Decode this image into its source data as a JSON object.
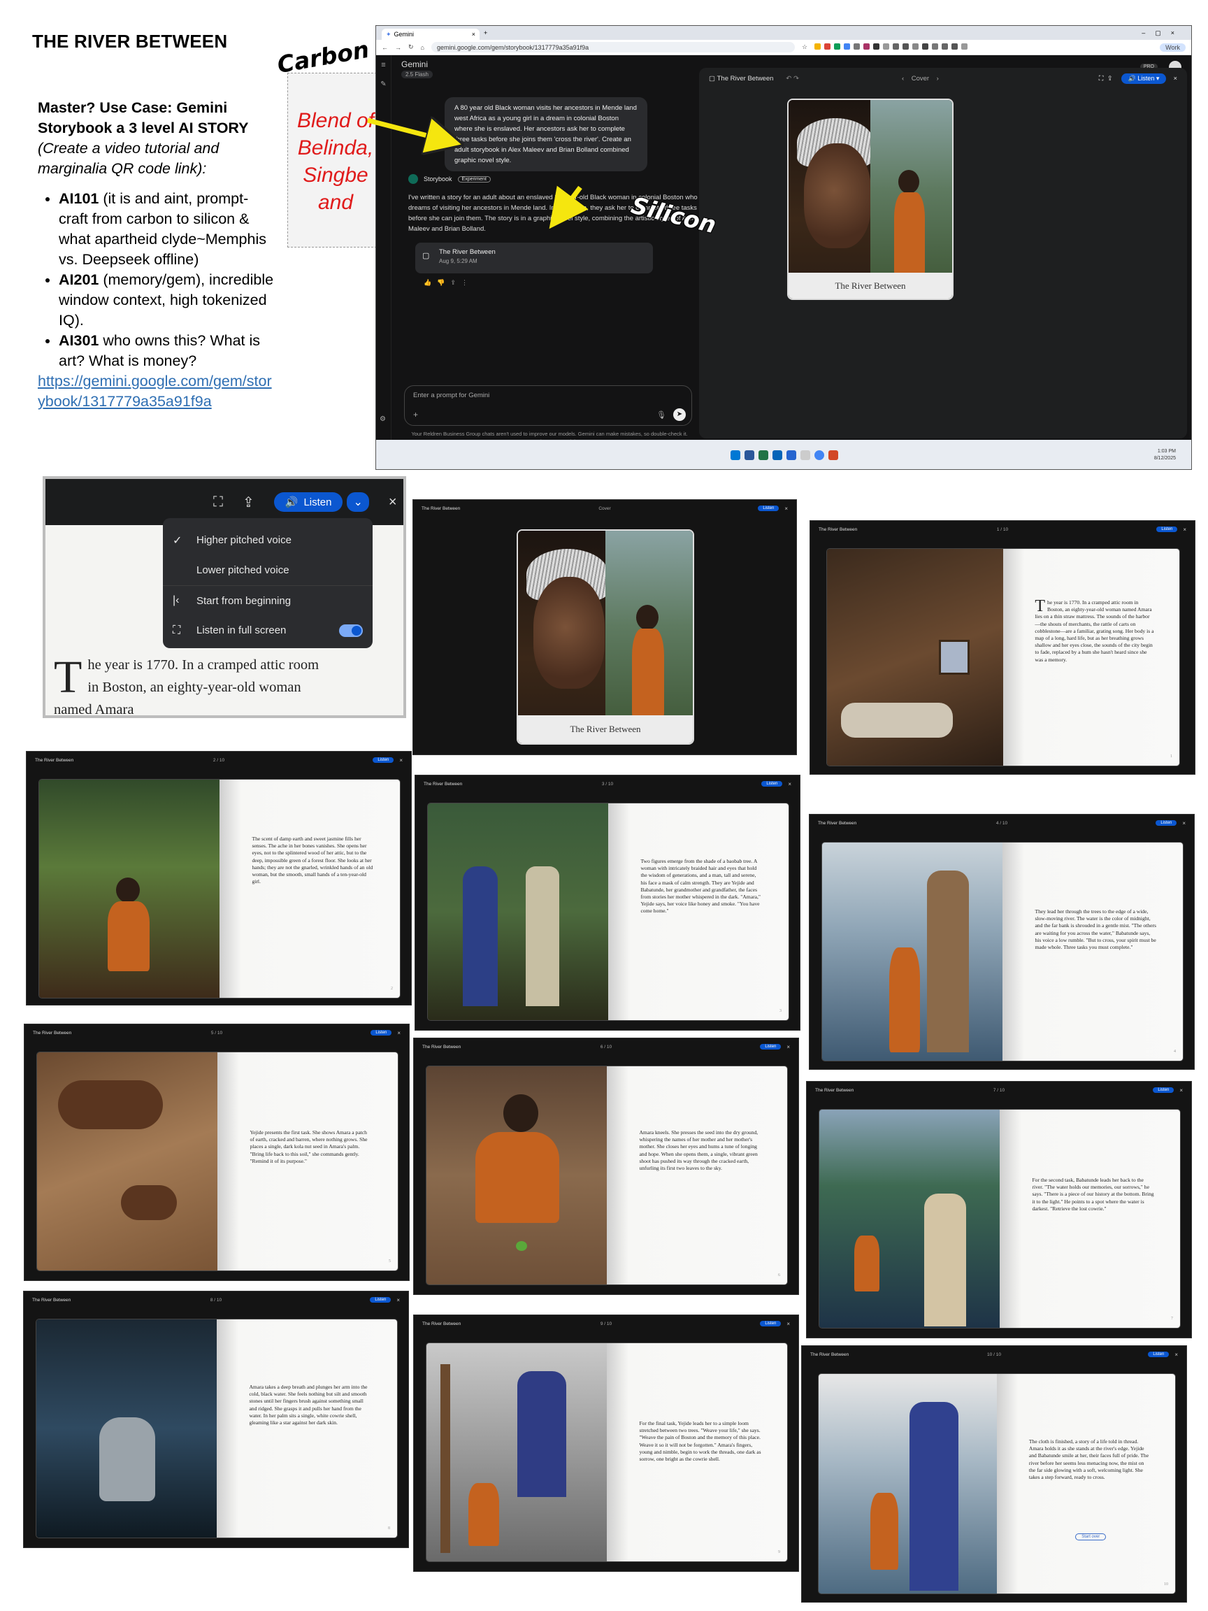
{
  "doc_title": "THE RIVER BETWEEN",
  "notes": {
    "heading": "Master? Use Case: Gemini Storybook a 3 level AI STORY",
    "subheading": "(Create a video tutorial and marginalia QR code link):",
    "items": [
      {
        "label": "AI101",
        "text": " (it is and aint, prompt-craft from carbon to silicon & what apartheid clyde~Memphis vs. Deepseek offline)"
      },
      {
        "label": "AI201",
        "text": " (memory/gem), incredible window context, high tokenized IQ)."
      },
      {
        "label": "AI301",
        "text": " who owns this? What is art? What is money?"
      }
    ],
    "link": "https://gemini.google.com/gem/storybook/1317779a35a91f9a"
  },
  "callouts": {
    "carbon": "Carbon",
    "silicon": "Silicon"
  },
  "sticky": "Blend of Belinda, Singbe and",
  "browser": {
    "tab_title": "Gemini",
    "url": "gemini.google.com/gem/storybook/1317779a35a91f9a",
    "profile": "Work",
    "app_name": "Gemini",
    "model": "2.5 Flash",
    "pro_badge": "PRO",
    "user_prompt": "A 80 year old Black woman visits her ancestors in Mende land west Africa as a young girl in a dream in colonial Boston where she is enslaved. Her ancestors ask her to complete three tasks before she joins them 'cross the river'. Create an adult storybook in Alex Maleev and Brian Bolland combined graphic novel style.",
    "bot_name": "Storybook",
    "bot_badge": "Experiment",
    "bot_reply": "I've written a story for an adult about an enslaved 80-year-old Black woman in colonial Boston who dreams of visiting her ancestors in Mende land. In the dream, they ask her to complete three tasks before she can join them. The story is in a graphic novel style, combining the artistic styles of Alex Maleev and Brian Bolland.",
    "story_card_title": "The River Between",
    "story_card_date": "Aug 9, 5:29 AM",
    "prompt_placeholder": "Enter a prompt for Gemini",
    "footnote": "Your Reldren Business Group chats aren't used to improve our models. Gemini can make mistakes, so double-check it. Your privacy & Gemini",
    "canvas_title": "The River Between",
    "canvas_page": "Cover",
    "listen": "Listen",
    "cover_title": "The River Between",
    "clock_time": "1:03 PM",
    "clock_date": "8/12/2025"
  },
  "zoom": {
    "listen": "Listen",
    "menu": [
      "Higher pitched voice",
      "Lower pitched voice",
      "Start from beginning",
      "Listen in full screen"
    ],
    "text": "he year is 1770. In a cramped attic room in Boston, an eighty-year-old woman named Amara",
    "dropcap": "T"
  },
  "pages": {
    "title": "The River Between",
    "listen": "Listen",
    "cover": {
      "label": "Cover",
      "title": "The River Between"
    },
    "p1": {
      "label": "1 / 10",
      "num": "1",
      "dropcap": "T",
      "text": "he year is 1770. In a cramped attic room in Boston, an eighty-year-old woman named Amara lies on a thin straw mattress. The sounds of the harbor—the shouts of merchants, the rattle of carts on cobblestone—are a familiar, grating song. Her body is a map of a long, hard life, but as her breathing grows shallow and her eyes close, the sounds of the city begin to fade, replaced by a hum she hasn't heard since she was a memory."
    },
    "p2": {
      "label": "2 / 10",
      "num": "2",
      "text": "The scent of damp earth and sweet jasmine fills her senses. The ache in her bones vanishes. She opens her eyes, not to the splintered wood of her attic, but to the deep, impossible green of a forest floor. She looks at her hands; they are not the gnarled, wrinkled hands of an old woman, but the smooth, small hands of a ten-year-old girl."
    },
    "p3": {
      "label": "3 / 10",
      "num": "3",
      "text": "Two figures emerge from the shade of a baobab tree. A woman with intricately braided hair and eyes that hold the wisdom of generations, and a man, tall and serene, his face a mask of calm strength. They are Yejide and Babatunde, her grandmother and grandfather, the faces from stories her mother whispered in the dark. \"Amara,\" Yejide says, her voice like honey and smoke. \"You have come home.\""
    },
    "p4": {
      "label": "4 / 10",
      "num": "4",
      "text": "They lead her through the trees to the edge of a wide, slow-moving river. The water is the color of midnight, and the far bank is shrouded in a gentle mist. \"The others are waiting for you across the water,\" Babatunde says, his voice a low rumble. \"But to cross, your spirit must be made whole. Three tasks you must complete.\""
    },
    "p5": {
      "label": "5 / 10",
      "num": "5",
      "text": "Yejide presents the first task. She shows Amara a patch of earth, cracked and barren, where nothing grows. She places a single, dark kola nut seed in Amara's palm. \"Bring life back to this soil,\" she commands gently. \"Remind it of its purpose.\""
    },
    "p6": {
      "label": "6 / 10",
      "num": "6",
      "text": "Amara kneels. She presses the seed into the dry ground, whispering the names of her mother and her mother's mother. She closes her eyes and hums a tune of longing and hope. When she opens them, a single, vibrant green shoot has pushed its way through the cracked earth, unfurling its first two leaves to the sky."
    },
    "p7": {
      "label": "7 / 10",
      "num": "7",
      "text": "For the second task, Babatunde leads her back to the river. \"The water holds our memories, our sorrows,\" he says. \"There is a piece of our history at the bottom. Bring it to the light.\" He points to a spot where the water is darkest. \"Retrieve the lost cowrie.\""
    },
    "p8": {
      "label": "8 / 10",
      "num": "8",
      "text": "Amara takes a deep breath and plunges her arm into the cold, black water. She feels nothing but silt and smooth stones until her fingers brush against something small and ridged. She grasps it and pulls her hand from the water. In her palm sits a single, white cowrie shell, gleaming like a star against her dark skin."
    },
    "p9": {
      "label": "9 / 10",
      "num": "9",
      "text": "For the final task, Yejide leads her to a simple loom stretched between two trees. \"Weave your life,\" she says. \"Weave the pain of Boston and the memory of this place. Weave it so it will not be forgotten.\" Amara's fingers, young and nimble, begin to work the threads, one dark as sorrow, one bright as the cowrie shell."
    },
    "p10": {
      "label": "10 / 10",
      "num": "10",
      "text": "The cloth is finished, a story of a life told in thread. Amara holds it as she stands at the river's edge. Yejide and Babatunde smile at her, their faces full of pride. The river before her seems less menacing now, the mist on the far side glowing with a soft, welcoming light. She takes a step forward, ready to cross.",
      "button": "Start over"
    }
  },
  "colors": {
    "accent": "#0b57d0",
    "sticky_text": "#e01b1b",
    "arrow": "#f5e60f",
    "link": "#2f6fb3"
  }
}
